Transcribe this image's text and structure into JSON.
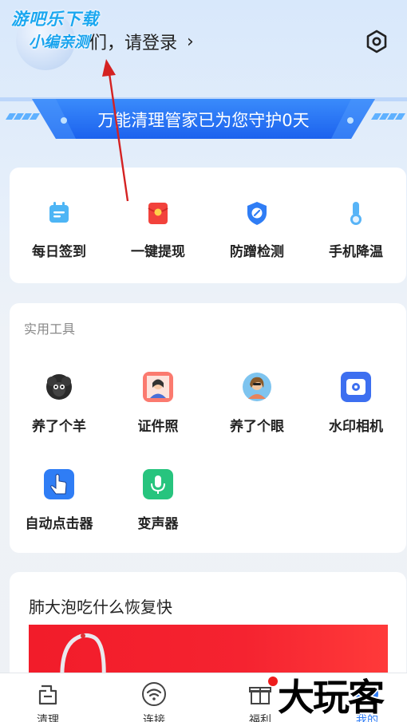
{
  "header": {
    "login_text": "们，请登录",
    "login_chevron": "›",
    "settings_icon": "hexagon-gear-icon"
  },
  "watermark": {
    "line1": "游吧乐下载",
    "line2": "小编亲测"
  },
  "banner": {
    "text": "万能清理管家已为您守护0天"
  },
  "quick_actions": [
    {
      "label": "每日签到",
      "icon": "calendar-icon"
    },
    {
      "label": "一键提现",
      "icon": "red-envelope-icon"
    },
    {
      "label": "防蹭检测",
      "icon": "shield-icon"
    },
    {
      "label": "手机降温",
      "icon": "thermometer-icon"
    }
  ],
  "tools": {
    "title": "实用工具",
    "items": [
      {
        "label": "养了个羊",
        "icon": "sheep-icon"
      },
      {
        "label": "证件照",
        "icon": "id-photo-icon"
      },
      {
        "label": "养了个眼",
        "icon": "portrait-icon"
      },
      {
        "label": "水印相机",
        "icon": "watermark-camera-icon"
      },
      {
        "label": "自动点击器",
        "icon": "auto-clicker-icon"
      },
      {
        "label": "变声器",
        "icon": "voice-changer-icon"
      }
    ]
  },
  "article": {
    "title": "肺大泡吃什么恢复快"
  },
  "tabbar": {
    "items": [
      {
        "label": "清理",
        "icon": "clean-icon"
      },
      {
        "label": "连接",
        "icon": "wifi-icon"
      },
      {
        "label": "福利",
        "icon": "gift-icon"
      },
      {
        "label": "我的",
        "icon": "profile-icon"
      }
    ],
    "overlay_text": "大玩客"
  },
  "colors": {
    "accent": "#1f6ff2",
    "banner": "#2a7bf6",
    "tool_bg": "#ffffff"
  }
}
